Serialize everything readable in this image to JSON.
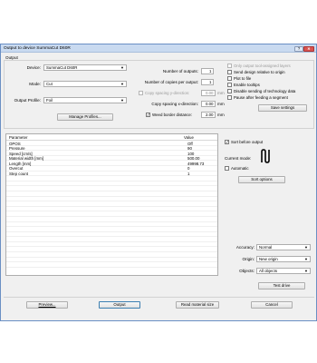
{
  "window": {
    "title": "Output to device SummaCut D60R",
    "help": "?",
    "close": "✕"
  },
  "output_group": {
    "label": "Output"
  },
  "left": {
    "device_label": "Device:",
    "device_value": "SummaCut D60R",
    "mode_label": "Mode:",
    "mode_value": "Cut",
    "profile_label": "Output Profile:",
    "profile_value": "Foil",
    "manage_profiles": "Manage Profiles..."
  },
  "middle": {
    "num_outputs_label": "Number of outputs:",
    "num_outputs_value": "1",
    "copies_per_output_label": "Number of copies per output:",
    "copies_per_output_value": "1",
    "copy_spacing_y_label": "Copy spacing y-direction:",
    "copy_spacing_y_value": "0.00",
    "copy_spacing_y_unit": "mm",
    "copy_spacing_x_label": "Copy spacing x-direction:",
    "copy_spacing_x_value": "0.00",
    "copy_spacing_x_unit": "mm",
    "weed_border_label": "Weed border distance:",
    "weed_border_value": "2.00",
    "weed_border_unit": "mm"
  },
  "right": {
    "only_output_tool": "Only output tool-assigned layers",
    "send_relative": "Send design relative to origin",
    "plot_to_file": "Plot to file",
    "enable_tooltips": "Enable tooltips",
    "disable_tech_data": "Disable sending of technology data",
    "pause_after_segment": "Pause after feeding a segment",
    "save_settings": "Save settings"
  },
  "table": {
    "col_parameter": "Parameter",
    "col_value": "Value",
    "rows": [
      {
        "param": "OPOS",
        "value": "Off"
      },
      {
        "param": "Pressure",
        "value": "90"
      },
      {
        "param": "Speed [cm/s]",
        "value": "100"
      },
      {
        "param": "Material width [mm]",
        "value": "500.00"
      },
      {
        "param": "Length [mm]",
        "value": "49998.73"
      },
      {
        "param": "Overcut",
        "value": "0"
      },
      {
        "param": "Step count",
        "value": "1"
      }
    ]
  },
  "sort_panel": {
    "sort_before_output": "Sort before output",
    "current_mode_label": "Current mode:",
    "automatic": "Automatic",
    "sort_options": "Sort options",
    "accuracy_label": "Accuracy:",
    "accuracy_value": "Normal",
    "origin_label": "Origin:",
    "origin_value": "New origin",
    "objects_label": "Objects:",
    "objects_value": "All objects",
    "test_drive": "Test drive"
  },
  "footer": {
    "preview": "Preview...",
    "output": "Output",
    "read_material_size": "Read material size",
    "cancel": "Cancel"
  },
  "colors": {
    "title_bar": "#c9daf0",
    "close_button": "#d9534f",
    "window_bg": "#f0f0f0"
  }
}
